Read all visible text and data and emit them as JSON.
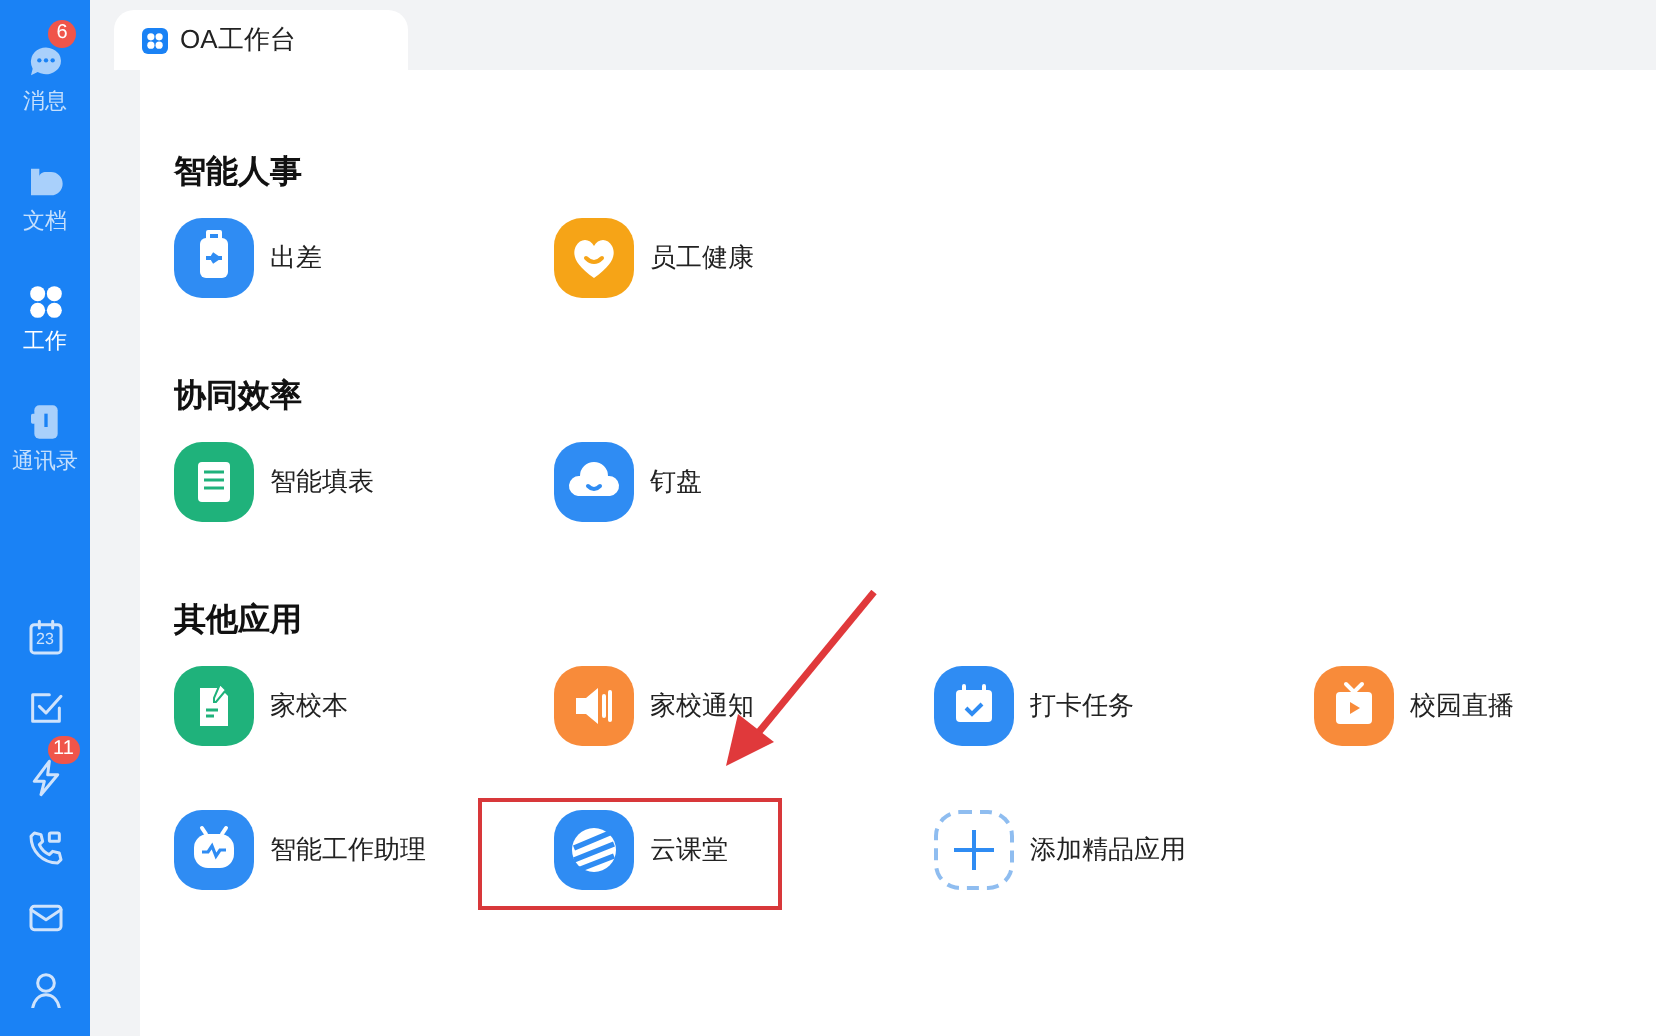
{
  "sidebar": {
    "items": [
      {
        "label": "消息",
        "badge": "6",
        "selected": false
      },
      {
        "label": "文档",
        "selected": false
      },
      {
        "label": "工作",
        "selected": true
      },
      {
        "label": "通讯录",
        "selected": false
      }
    ],
    "calendar_date": "23",
    "alerts_badge": "11"
  },
  "tab": {
    "label": "OA工作台",
    "selected": true
  },
  "sections": [
    {
      "title": "智能人事",
      "apps": [
        {
          "label": "出差",
          "kind": "app"
        },
        {
          "label": "员工健康",
          "kind": "app"
        }
      ]
    },
    {
      "title": "协同效率",
      "apps": [
        {
          "label": "智能填表",
          "kind": "app"
        },
        {
          "label": "钉盘",
          "kind": "app"
        }
      ]
    },
    {
      "title": "其他应用",
      "apps": [
        {
          "label": "家校本",
          "kind": "app"
        },
        {
          "label": "家校通知",
          "kind": "app"
        },
        {
          "label": "打卡任务",
          "kind": "app"
        },
        {
          "label": "校园直播",
          "kind": "app"
        },
        {
          "label": "智能工作助理",
          "kind": "app"
        },
        {
          "label": "云课堂",
          "kind": "app",
          "highlighted": true
        },
        {
          "label": "添加精品应用",
          "kind": "add"
        }
      ]
    }
  ]
}
